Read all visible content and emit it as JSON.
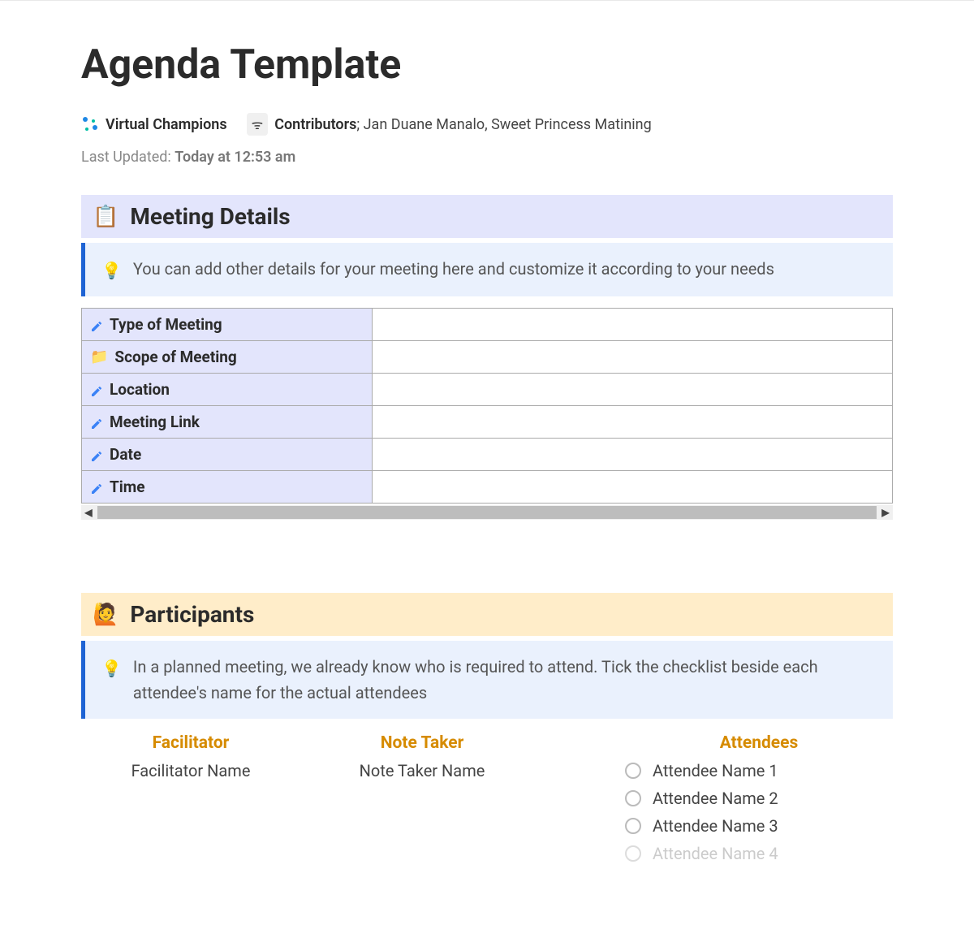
{
  "title": "Agenda Template",
  "meta": {
    "org_name": "Virtual Champions",
    "contributors_label": "Contributors",
    "contributors_names": "Jan Duane Manalo, Sweet Princess Matining",
    "last_updated_label": "Last Updated:",
    "last_updated_value": "Today at 12:53 am"
  },
  "sections": {
    "details": {
      "icon": "📋",
      "heading": "Meeting Details",
      "callout_icon": "💡",
      "callout_text": "You can add other details for your meeting here and customize it according to your needs",
      "rows": [
        {
          "icon": "pencil",
          "label": "Type of Meeting",
          "value": ""
        },
        {
          "icon": "folder",
          "label": "Scope of Meeting",
          "value": ""
        },
        {
          "icon": "pencil",
          "label": "Location",
          "value": ""
        },
        {
          "icon": "pencil",
          "label": "Meeting Link",
          "value": ""
        },
        {
          "icon": "pencil",
          "label": "Date",
          "value": ""
        },
        {
          "icon": "pencil",
          "label": "Time",
          "value": ""
        }
      ]
    },
    "participants": {
      "icon": "🙋",
      "heading": "Participants",
      "callout_icon": "💡",
      "callout_text": "In a planned meeting, we already know who is required to attend. Tick the checklist beside each attendee's name for the actual attendees",
      "facilitator_label": "Facilitator",
      "facilitator_value": "Facilitator Name",
      "notetaker_label": "Note Taker",
      "notetaker_value": "Note Taker Name",
      "attendees_label": "Attendees",
      "attendees": [
        "Attendee Name 1",
        "Attendee Name 2",
        "Attendee Name 3",
        "Attendee Name 4"
      ]
    }
  }
}
